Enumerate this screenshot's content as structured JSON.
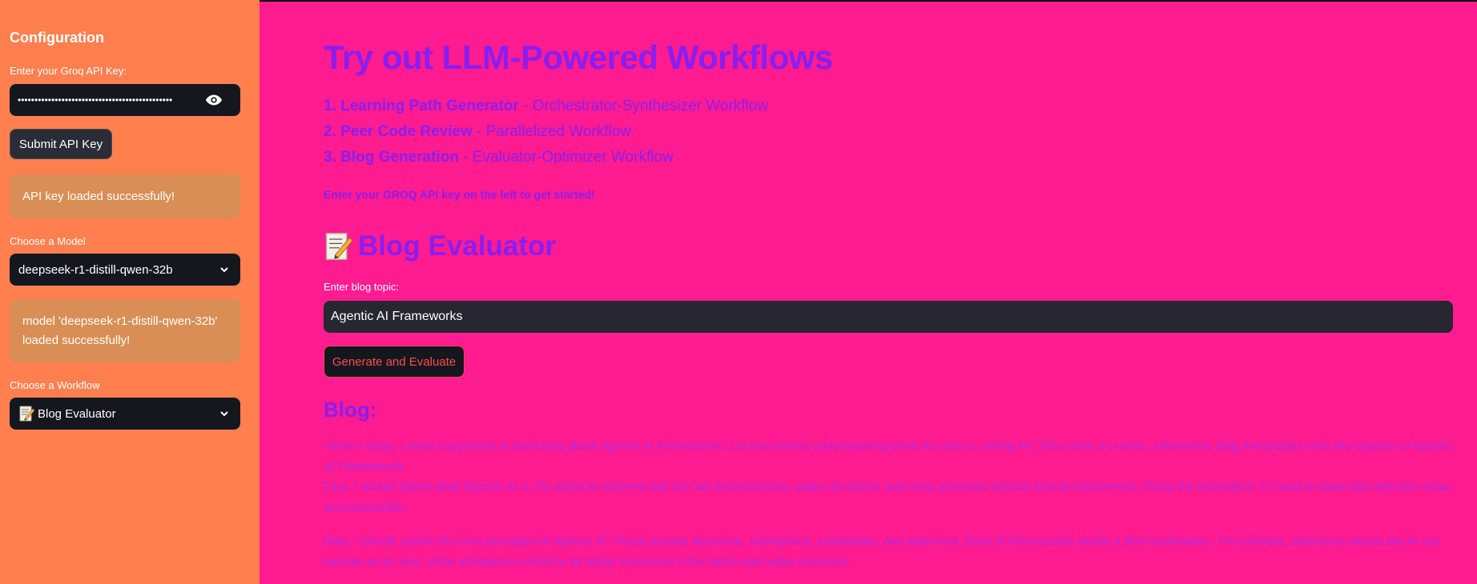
{
  "sidebar": {
    "title": "Configuration",
    "api_key_label": "Enter your Groq API Key:",
    "api_key_value": "••••••••••••••••••••••••••••••••••••••••••••••",
    "submit_label": "Submit API Key",
    "api_success": "API key loaded successfully!",
    "model_label": "Choose a Model",
    "model_value": "deepseek-r1-distill-qwen-32b",
    "model_success": "model 'deepseek-r1-distill-qwen-32b' loaded successfully!",
    "workflow_label": "Choose a Workflow",
    "workflow_value": "Blog Evaluator"
  },
  "main": {
    "title": "Try out LLM-Powered Workflows",
    "workflows": [
      {
        "name": "1. Learning Path Generator",
        "desc": " - Orchestrator-Synthesizer Workflow"
      },
      {
        "name": "2. Peer Code Review",
        "desc": " - Parallelized Workflow"
      },
      {
        "name": "3. Blog Generation",
        "desc": " - Evaluator-Optimizer Workflow"
      }
    ],
    "hint": "Enter your GROQ API key on the left to get started!",
    "section_title": "Blog Evaluator",
    "topic_label": "Enter blog topic:",
    "topic_value": "Agentic AI Frameworks",
    "generate_label": "Generate and Evaluate",
    "blog_heading": "Blog:",
    "blog_paragraphs": [
      "<think> Okay, I need to generate a short blog about Agentic AI Frameworks. Let me start by understanding what the user is asking for. They want a concise, informative blog that explains the key aspects of Agentic AI Frameworks.",
      "First, I should define what Agentic AI is. It's about AI systems that can act autonomously, make decisions, and solve problems without human intervention. That's the foundation. I'll need to make this definition clear and accessible.",
      "Next, I should outline the core principles of Agentic AI. These include autonomy, intelligence, adaptability, and alignment. Each of these points needs a brief explanation. For example, autonomy means the AI can operate on its own, while intelligence refers to its ability to process information and make decisions."
    ]
  },
  "colors": {
    "sidebar_bg": "#ff7f4f",
    "main_bg": "#ff1b90",
    "heading": "#8a1ef0",
    "blog_text": "#b32ae0",
    "alert_bg": "#d98e55",
    "button_accent": "#ff4b4b"
  },
  "icons": [
    "eye-icon",
    "chevron-down-icon",
    "memo-icon"
  ]
}
